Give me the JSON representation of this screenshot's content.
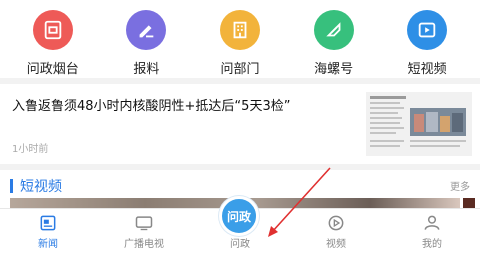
{
  "shortcuts": [
    {
      "label": "问政烟台",
      "icon": "wenzheng-icon",
      "color": "#ee5a57"
    },
    {
      "label": "报料",
      "icon": "edit-icon",
      "color": "#7a6fe0"
    },
    {
      "label": "问部门",
      "icon": "building-icon",
      "color": "#f2b33b"
    },
    {
      "label": "海螺号",
      "icon": "conch-icon",
      "color": "#37c07d"
    },
    {
      "label": "短视频",
      "icon": "video-icon",
      "color": "#2e8fe6"
    }
  ],
  "news": {
    "headline": "入鲁返鲁须48小时内核酸阴性+抵达后“5天3检”",
    "time": "1小时前"
  },
  "section": {
    "title": "短视频",
    "more": "更多"
  },
  "tabbar": {
    "tabs": [
      {
        "label": "新闻",
        "icon": "news-icon",
        "active": true
      },
      {
        "label": "广播电视",
        "icon": "tv-icon",
        "active": false
      },
      {
        "label": "问政",
        "icon": "wenzheng-tab-icon",
        "active": false
      },
      {
        "label": "视频",
        "icon": "play-icon",
        "active": false
      },
      {
        "label": "我的",
        "icon": "person-icon",
        "active": false
      }
    ],
    "center_label": "问政"
  },
  "colors": {
    "accent": "#2a7be4",
    "annotation_arrow": "#e03030"
  }
}
